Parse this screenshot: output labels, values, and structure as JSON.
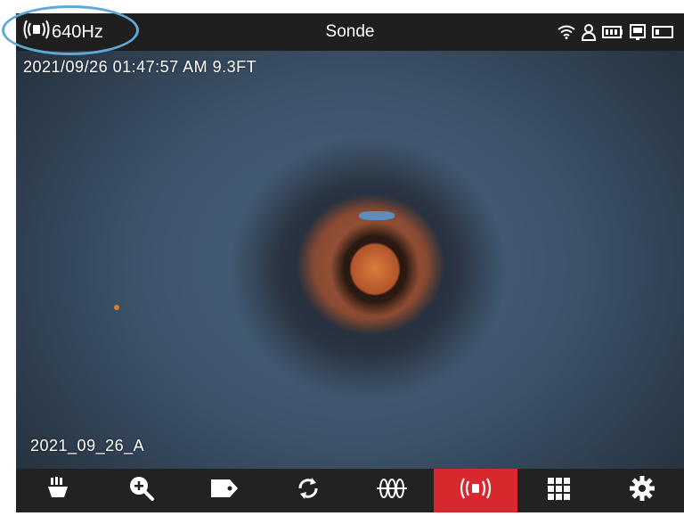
{
  "header": {
    "frequency": "640Hz",
    "mode_title": "Sonde"
  },
  "camera": {
    "timestamp_overlay": "2021/09/26 01:47:57 AM 9.3FT",
    "filename_overlay": "2021_09_26_A"
  },
  "status_icons": [
    "wifi-icon",
    "user-icon",
    "battery-icon",
    "storage-icon",
    "card-icon"
  ],
  "toolbar": {
    "buttons": [
      {
        "name": "light-icon",
        "active": false
      },
      {
        "name": "zoom-in-icon",
        "active": false
      },
      {
        "name": "tag-icon",
        "active": false
      },
      {
        "name": "rotate-icon",
        "active": false
      },
      {
        "name": "meter-counter-icon",
        "active": false
      },
      {
        "name": "sonde-icon",
        "active": true
      },
      {
        "name": "grid-icon",
        "active": false
      },
      {
        "name": "settings-icon",
        "active": false
      }
    ]
  },
  "colors": {
    "active_tool": "#d9272e",
    "highlight_ring": "#5ea9d8",
    "bar_background": "#1f1f1f"
  }
}
